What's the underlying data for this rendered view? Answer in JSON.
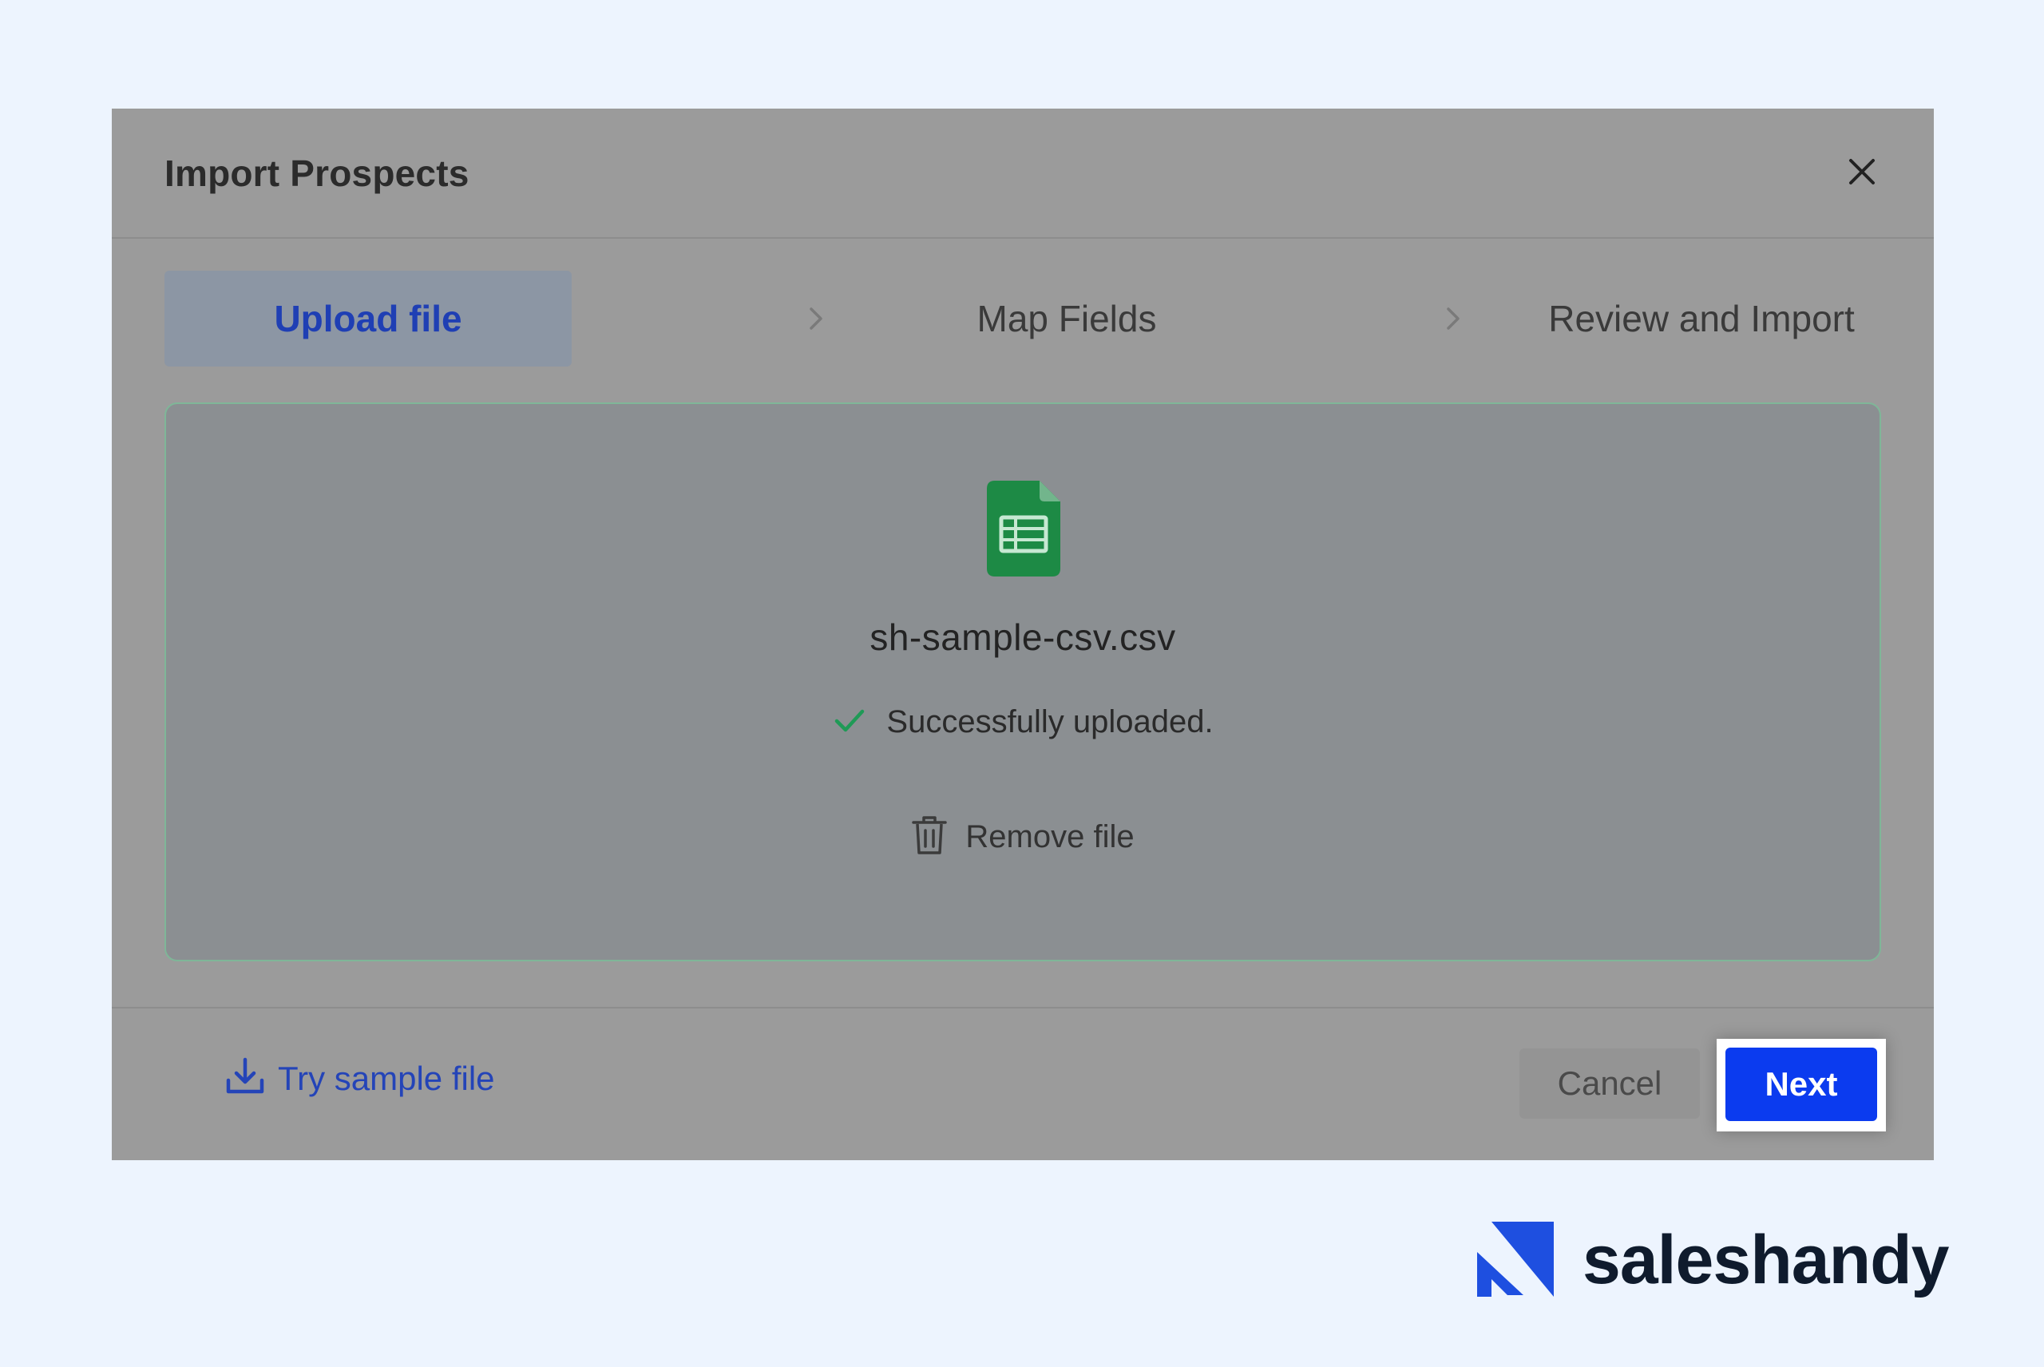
{
  "modal": {
    "title": "Import Prospects",
    "close_icon": "close-icon"
  },
  "stepper": {
    "steps": [
      {
        "label": "Upload file",
        "active": true
      },
      {
        "label": "Map Fields",
        "active": false
      },
      {
        "label": "Review and Import",
        "active": false
      }
    ],
    "separator_icon": "chevron-right-icon"
  },
  "upload": {
    "file_icon": "spreadsheet-file-icon",
    "file_name": "sh-sample-csv.csv",
    "status_icon": "check-icon",
    "status_text": "Successfully uploaded.",
    "remove_icon": "trash-icon",
    "remove_label": "Remove file"
  },
  "footer": {
    "sample_icon": "download-icon",
    "sample_label": "Try sample file",
    "cancel_label": "Cancel",
    "next_label": "Next"
  },
  "brand": {
    "name": "saleshandy"
  },
  "colors": {
    "page_bg": "#edf4fe",
    "modal_bg": "#9b9b9b",
    "primary": "#0b3bef",
    "active_step_text": "#1f3fb4",
    "success": "#1f9a56",
    "file_icon": "#1d8a45"
  }
}
